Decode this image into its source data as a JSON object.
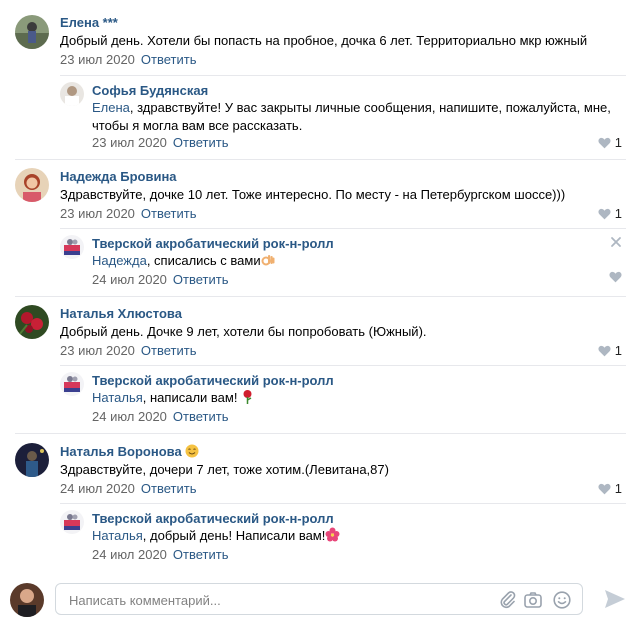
{
  "comments": [
    {
      "author": "Елена ***",
      "text": "Добрый день. Хотели бы попасть на пробное, дочка 6 лет. Территориально мкр южный",
      "date": "23 июл 2020",
      "reply_label": "Ответить",
      "replies": [
        {
          "author": "Софья Будянская",
          "mention": "Елена",
          "text": ", здравствуйте! У вас закрыты личные сообщения, напишите, пожалуйста, мне, чтобы я могла вам все рассказать.",
          "date": "23 июл 2020",
          "reply_label": "Ответить",
          "likes": "1"
        }
      ]
    },
    {
      "author": "Надежда Бровина",
      "text": "Здравствуйте, дочке 10 лет. Тоже интересно. По месту - на Петербургском шоссе)))",
      "date": "23 июл 2020",
      "reply_label": "Ответить",
      "likes": "1",
      "replies": [
        {
          "author": "Тверской акробатический рок-н-ролл",
          "mention": "Надежда",
          "text": ", списались с вами",
          "emoji": "ok-hand",
          "date": "24 июл 2020",
          "reply_label": "Ответить"
        }
      ]
    },
    {
      "author": "Наталья Хлюстова",
      "text": "Добрый день. Дочке 9 лет, хотели бы попробовать (Южный).",
      "date": "23 июл 2020",
      "reply_label": "Ответить",
      "likes": "1",
      "replies": [
        {
          "author": "Тверской акробатический рок-н-ролл",
          "mention": "Наталья",
          "text": ", написали вам!",
          "emoji": "rose",
          "date": "24 июл 2020",
          "reply_label": "Ответить"
        }
      ]
    },
    {
      "author": "Наталья Воронова",
      "author_emoji": "smiling-face",
      "text": "Здравствуйте, дочери 7 лет, тоже хотим.(Левитана,87)",
      "date": "24 июл 2020",
      "reply_label": "Ответить",
      "likes": "1",
      "replies": [
        {
          "author": "Тверской акробатический рок-н-ролл",
          "mention": "Наталья",
          "text": ", добрый день! Написали вам!",
          "emoji": "hibiscus",
          "date": "24 июл 2020",
          "reply_label": "Ответить"
        }
      ]
    }
  ],
  "composer": {
    "placeholder": "Написать комментарий...",
    "icons": [
      "paperclip-icon",
      "camera-icon",
      "smile-icon",
      "send-icon"
    ]
  },
  "colors": {
    "link": "#2a5885",
    "meta": "#656565",
    "separator": "#e7e8ec",
    "heart": "#aeb7c2"
  }
}
